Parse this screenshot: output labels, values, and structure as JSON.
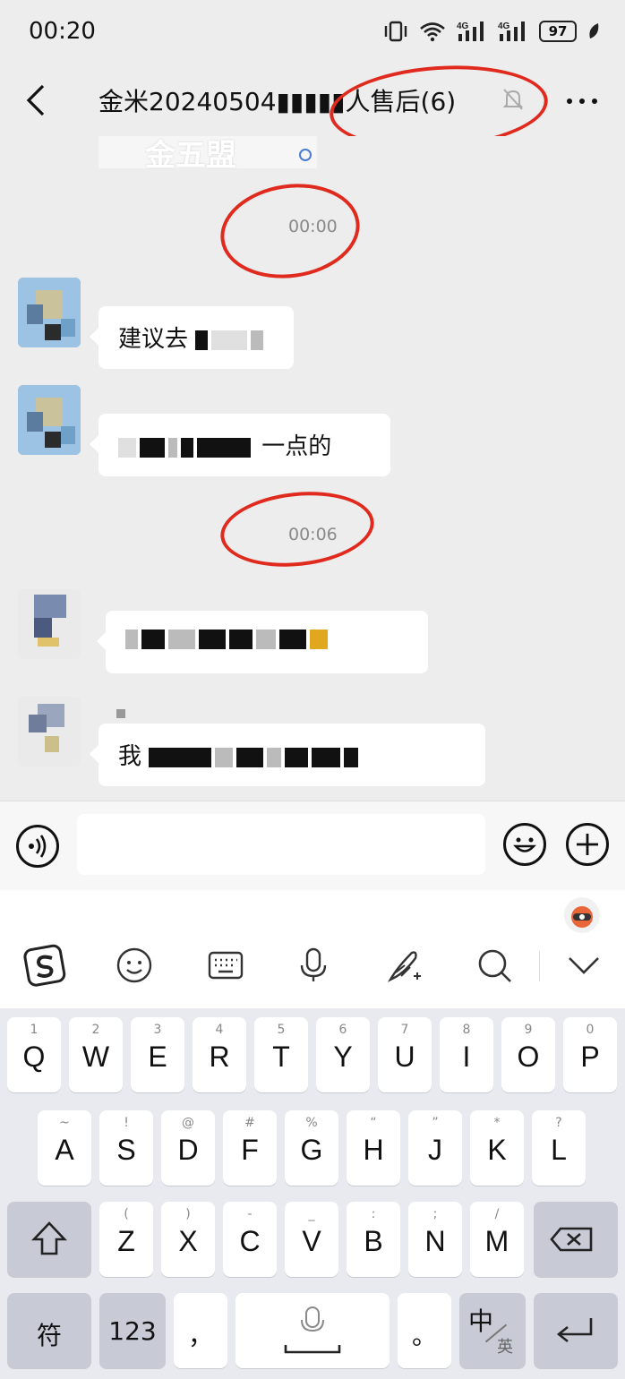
{
  "status_bar": {
    "time": "00:20",
    "battery": "97",
    "network_1": "4G",
    "network_2": "4G"
  },
  "header": {
    "title": "金米20240504▮▮▮▮▮人售后(6)"
  },
  "pinned": {
    "text": "金五盟"
  },
  "messages": [
    {
      "type": "timestamp",
      "text": "00:00"
    },
    {
      "type": "incoming",
      "visible_text": "建议去"
    },
    {
      "type": "incoming",
      "visible_text": "一点的"
    },
    {
      "type": "timestamp",
      "text": "00:06"
    },
    {
      "type": "incoming",
      "visible_text": ""
    },
    {
      "type": "incoming",
      "visible_text": "我"
    }
  ],
  "input": {
    "value": "",
    "placeholder": ""
  },
  "toolbar_icons": [
    "sogou-logo-icon",
    "emoji-icon",
    "keyboard-icon",
    "microphone-icon",
    "handwriting-icon",
    "search-icon",
    "collapse-icon"
  ],
  "keyboard": {
    "row1": [
      {
        "hint": "1",
        "key": "Q"
      },
      {
        "hint": "2",
        "key": "W"
      },
      {
        "hint": "3",
        "key": "E"
      },
      {
        "hint": "4",
        "key": "R"
      },
      {
        "hint": "5",
        "key": "T"
      },
      {
        "hint": "6",
        "key": "Y"
      },
      {
        "hint": "7",
        "key": "U"
      },
      {
        "hint": "8",
        "key": "I"
      },
      {
        "hint": "9",
        "key": "O"
      },
      {
        "hint": "0",
        "key": "P"
      }
    ],
    "row2": [
      {
        "hint": "~",
        "key": "A"
      },
      {
        "hint": "!",
        "key": "S"
      },
      {
        "hint": "@",
        "key": "D"
      },
      {
        "hint": "#",
        "key": "F"
      },
      {
        "hint": "%",
        "key": "G"
      },
      {
        "hint": "“",
        "key": "H"
      },
      {
        "hint": "”",
        "key": "J"
      },
      {
        "hint": "*",
        "key": "K"
      },
      {
        "hint": "?",
        "key": "L"
      }
    ],
    "row3": [
      {
        "hint": "(",
        "key": "Z"
      },
      {
        "hint": ")",
        "key": "X"
      },
      {
        "hint": "-",
        "key": "C"
      },
      {
        "hint": "_",
        "key": "V"
      },
      {
        "hint": ":",
        "key": "B"
      },
      {
        "hint": ";",
        "key": "N"
      },
      {
        "hint": "/",
        "key": "M"
      }
    ],
    "symbol_key": "符",
    "number_key": "123",
    "comma_key": "，",
    "period_key": "。",
    "lang_key_main": "中",
    "lang_key_sub": "英"
  },
  "colors": {
    "background": "#ededed",
    "bubble": "#ffffff",
    "annotation_red": "#e02a1e",
    "keyboard_bg": "#e9eaef"
  }
}
